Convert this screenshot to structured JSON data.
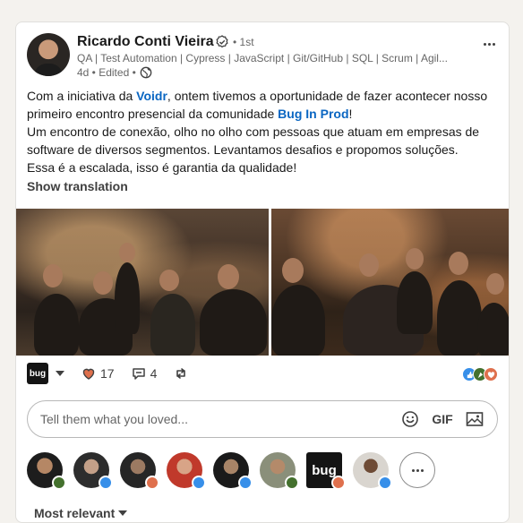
{
  "post": {
    "author": {
      "name": "Ricardo Conti Vieira",
      "degree": "• 1st",
      "headline": "QA | Test Automation | Cypress | JavaScript | Git/GitHub | SQL | Scrum | Agil...",
      "meta": "4d • Edited •"
    },
    "text": {
      "p1a": "Com a iniciativa da ",
      "link1": "Voidr",
      "p1b": ", ontem tivemos a oportunidade de fazer acontecer nosso primeiro encontro presencial da comunidade ",
      "link2": "Bug In Prod",
      "p1c": "!",
      "p2": "Um encontro de conexão, olho no olho com pessoas que atuam em empresas de software de diversos segmentos. Levantamos desafios e propomos soluções.",
      "p3": "Essa é a escalada, isso é garantia da qualidade!"
    },
    "show_translation": "Show translation"
  },
  "social": {
    "identity_logo": "bug",
    "reactions_count": "17",
    "comments_count": "4"
  },
  "comment_box": {
    "placeholder": "Tell them what you loved...",
    "gif_label": "GIF"
  },
  "reactors": [
    "celebrate",
    "like",
    "love",
    "like",
    "like",
    "celebrate",
    "love",
    "like"
  ],
  "reactor_logo": "bug",
  "sort_label": "Most relevant",
  "colors": {
    "link": "#0a66c2",
    "like": "#378fe9",
    "love": "#df704d",
    "celebrate": "#44712e"
  }
}
